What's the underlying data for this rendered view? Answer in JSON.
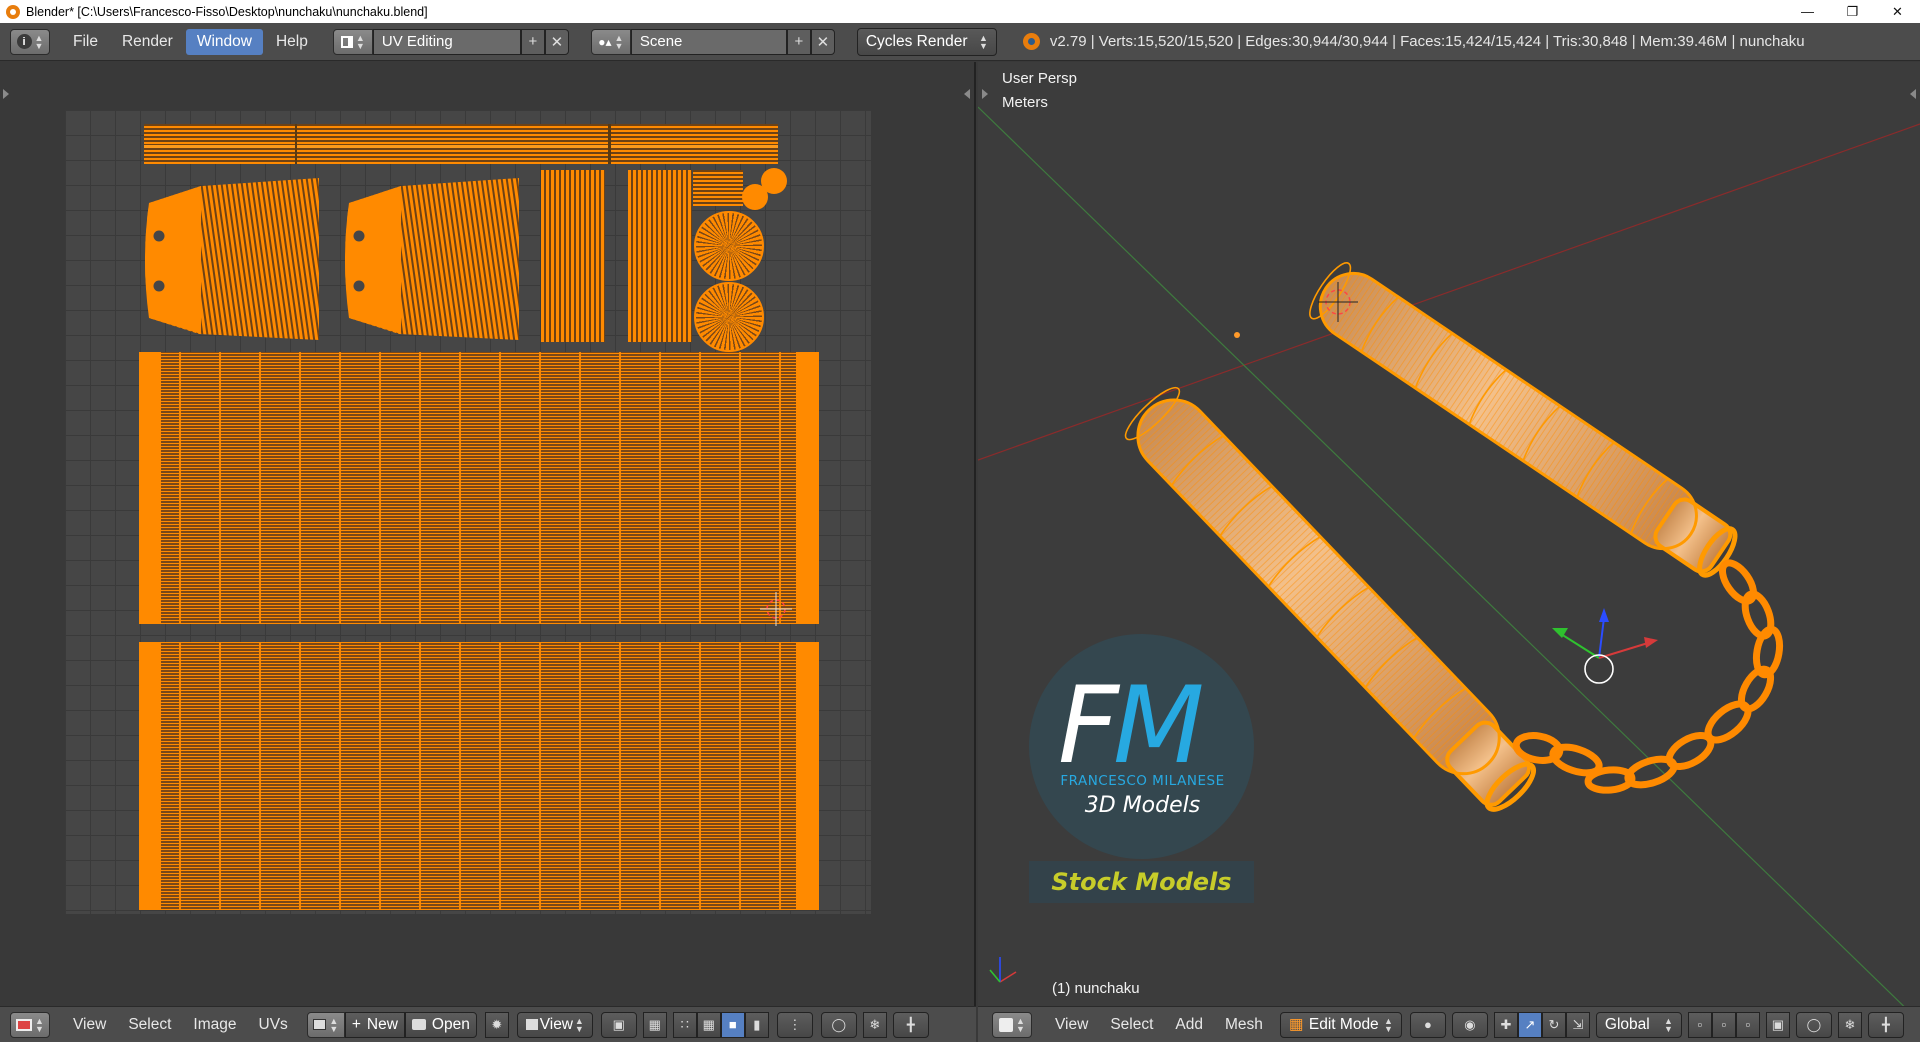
{
  "window": {
    "title": "Blender* [C:\\Users\\Francesco-Fisso\\Desktop\\nunchaku\\nunchaku.blend]",
    "minimize_icon": "minimize-icon",
    "maximize_icon": "restore-icon",
    "close_icon": "close-icon"
  },
  "top_menu": {
    "items": [
      "File",
      "Render",
      "Window",
      "Help"
    ],
    "active": "Window",
    "screen_layout": "UV Editing",
    "scene": "Scene",
    "render_engine": "Cycles Render",
    "stats": "v2.79 | Verts:15,520/15,520 | Edges:30,944/30,944 | Faces:15,424/15,424 | Tris:30,848 | Mem:39.46M | nunchaku"
  },
  "viewport": {
    "view_name": "User Persp",
    "units": "Meters",
    "object_label": "(1) nunchaku"
  },
  "logo": {
    "letter_f": "F",
    "letter_m": "M",
    "name": "FRANCESCO MILANESE",
    "subtitle": "3D Models",
    "tagline": "Stock Models",
    "colors": {
      "circle": "#34474f",
      "m": "#27a9e1",
      "tagline": "#c7cc2a"
    }
  },
  "uv_bottom_bar": {
    "menus": [
      "View",
      "Select",
      "Image",
      "UVs"
    ],
    "new_label": "New",
    "open_label": "Open",
    "view_dropdown": "View"
  },
  "view3d_bottom_bar": {
    "menus": [
      "View",
      "Select",
      "Add",
      "Mesh"
    ],
    "mode": "Edit Mode",
    "orientation": "Global"
  },
  "colors": {
    "accent": "#5680c2",
    "uv_selected": "#ff8a00",
    "mesh": "#e8b27a"
  }
}
